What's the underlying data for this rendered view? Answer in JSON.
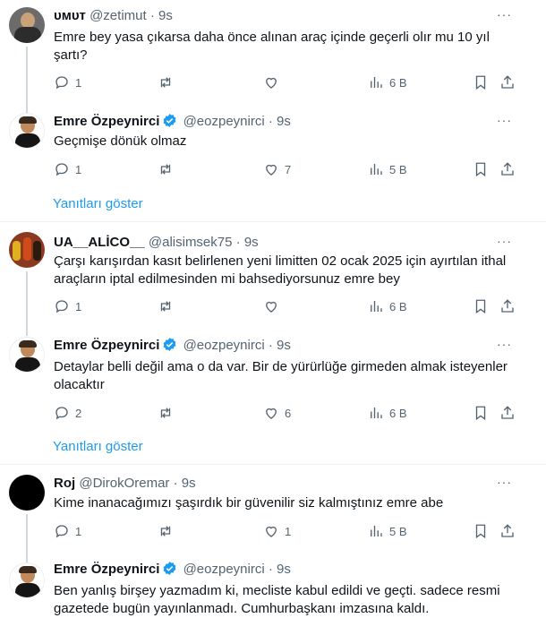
{
  "threads": [
    {
      "reply": {
        "name": "ᴜᴍᴜᴛ",
        "handle": "@zetimut",
        "dot": "·",
        "time": "9s",
        "text": "Emre bey yasa çıkarsa daha önce alınan araç içinde geçerli olır mu 10 yıl şartı?",
        "replies": "1",
        "reposts": "",
        "likes": "",
        "views": "6 B"
      },
      "answer": {
        "name": "Emre Özpeynirci",
        "handle": "@eozpeynirci",
        "dot": "·",
        "time": "9s",
        "text": "Geçmişe dönük olmaz",
        "replies": "1",
        "reposts": "",
        "likes": "7",
        "views": "5 B"
      },
      "show_replies": "Yanıtları göster"
    },
    {
      "reply": {
        "name": "UA__ALİCO__",
        "handle": "@alisimsek75",
        "dot": "·",
        "time": "9s",
        "text": "Çarşı karışırdan kasıt belirlenen yeni limitten 02 ocak 2025 için ayırtılan ithal araçların  iptal edilmesinden mi bahsediyorsunuz emre bey",
        "replies": "1",
        "reposts": "",
        "likes": "",
        "views": "6 B"
      },
      "answer": {
        "name": "Emre Özpeynirci",
        "handle": "@eozpeynirci",
        "dot": "·",
        "time": "9s",
        "text": "Detaylar belli değil ama o da var. Bir de yürürlüğe girmeden almak isteyenler olacaktır",
        "replies": "2",
        "reposts": "",
        "likes": "6",
        "views": "6 B"
      },
      "show_replies": "Yanıtları göster"
    },
    {
      "reply": {
        "name": "Roj",
        "handle": "@DirokOremar",
        "dot": "·",
        "time": "9s",
        "text": "Kime inanacağımızı şaşırdık bir güvenilir siz kalmıştınız emre abe",
        "replies": "1",
        "reposts": "",
        "likes": "1",
        "views": "5 B"
      },
      "answer": {
        "name": "Emre Özpeynirci",
        "handle": "@eozpeynirci",
        "dot": "·",
        "time": "9s",
        "text": "Ben yanlış birşey yazmadım ki, mecliste kabul edildi ve geçti. sadece resmi gazetede bugün yayınlanmadı. Cumhurbaşkanı imzasına kaldı."
      }
    }
  ],
  "more_label": "···",
  "colors": {
    "accent": "#1d9bf0",
    "muted": "#536471",
    "text": "#0f1419",
    "line": "#cfd9de"
  },
  "icons": [
    "reply-icon",
    "repost-icon",
    "like-icon",
    "views-icon",
    "bookmark-icon",
    "share-icon",
    "verified-icon",
    "more-icon"
  ]
}
